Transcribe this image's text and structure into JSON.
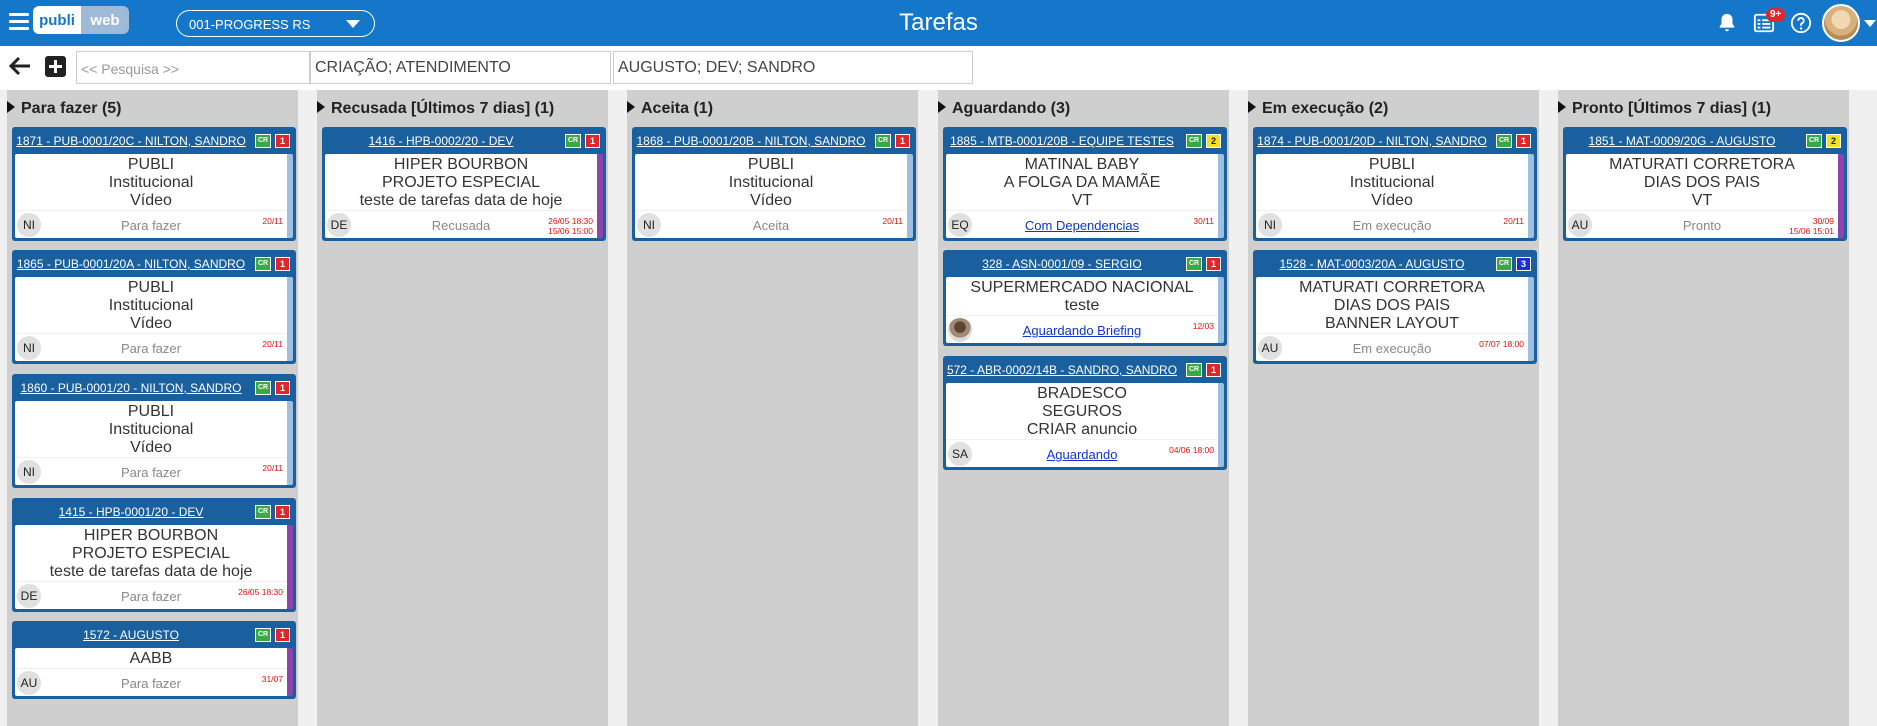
{
  "app": {
    "logo_left": "publi",
    "logo_right": "web",
    "page_title": "Tarefas",
    "notification_badge": "9+"
  },
  "colors": {
    "topbar": "#1577c9",
    "card_header": "#1a5f9e",
    "cr_badge": "#3aa845",
    "date_red": "#e01010"
  },
  "topbar": {
    "project_select": "001-PROGRESS RS"
  },
  "filters": {
    "search_placeholder": "<< Pesquisa >>",
    "category_filter": "CRIAÇÃO; ATENDIMENTO",
    "people_filter": "AUGUSTO; DEV; SANDRO"
  },
  "columns": [
    {
      "title": "Para fazer (5)",
      "cards": [
        {
          "link": "1871 - PUB-0001/20C - NILTON, SANDRO",
          "badge": "CR",
          "count": "1",
          "count_color": "#e0262b",
          "lines": [
            "PUBLI",
            "Institucional",
            "Vídeo"
          ],
          "initials": "NI",
          "status": "Para fazer",
          "date1": "20/11",
          "date2": ""
        },
        {
          "link": "1865 - PUB-0001/20A - NILTON, SANDRO",
          "badge": "CR",
          "count": "1",
          "count_color": "#e0262b",
          "lines": [
            "PUBLI",
            "Institucional",
            "Vídeo"
          ],
          "initials": "NI",
          "status": "Para fazer",
          "date1": "20/11",
          "date2": ""
        },
        {
          "link": "1860 - PUB-0001/20 - NILTON, SANDRO",
          "badge": "CR",
          "count": "1",
          "count_color": "#e0262b",
          "lines": [
            "PUBLI",
            "Institucional",
            "Vídeo"
          ],
          "initials": "NI",
          "status": "Para fazer",
          "date1": "20/11",
          "date2": ""
        },
        {
          "link": "1415 - HPB-0001/20 - DEV",
          "badge": "CR",
          "count": "1",
          "count_color": "#e0262b",
          "lines": [
            "HIPER BOURBON",
            "PROJETO ESPECIAL",
            "teste de tarefas data de hoje"
          ],
          "initials": "DE",
          "status": "Para fazer",
          "date1": "26/05 18:30",
          "date2": "",
          "purple": true
        },
        {
          "link": "1572 - AUGUSTO",
          "badge": "CR",
          "count": "1",
          "count_color": "#e0262b",
          "lines": [
            "AABB"
          ],
          "initials": "AU",
          "status": "Para fazer",
          "date1": "31/07",
          "date2": "",
          "purple": true
        }
      ]
    },
    {
      "title": "Recusada [Últimos 7 dias] (1)",
      "cards": [
        {
          "link": "1416 - HPB-0002/20 - DEV",
          "badge": "CR",
          "count": "1",
          "count_color": "#e0262b",
          "lines": [
            "HIPER BOURBON",
            "PROJETO ESPECIAL",
            "teste de tarefas data de hoje"
          ],
          "initials": "DE",
          "status": "Recusada",
          "date1": "26/05 18:30",
          "date2": "15/06 15:00",
          "purple": true
        }
      ]
    },
    {
      "title": "Aceita (1)",
      "cards": [
        {
          "link": "1868 - PUB-0001/20B - NILTON, SANDRO",
          "badge": "CR",
          "count": "1",
          "count_color": "#e0262b",
          "lines": [
            "PUBLI",
            "Institucional",
            "Vídeo"
          ],
          "initials": "NI",
          "status": "Aceita",
          "date1": "20/11",
          "date2": ""
        }
      ]
    },
    {
      "title": "Aguardando (3)",
      "cards": [
        {
          "link": "1885 - MTB-0001/20B - EQUIPE TESTES",
          "badge": "CR",
          "count": "2",
          "count_color": "#f2e21a",
          "lines": [
            "MATINAL BABY",
            "A FOLGA DA MAMÃE",
            "VT"
          ],
          "initials": "EQ",
          "status": "Com Dependencias",
          "status_link": true,
          "date1": "30/11",
          "date2": ""
        },
        {
          "link": "328 - ASN-0001/09 - SERGIO",
          "badge": "CR",
          "count": "1",
          "count_color": "#e0262b",
          "lines": [
            "SUPERMERCADO NACIONAL",
            "teste"
          ],
          "initials": "",
          "face": true,
          "status": "Aguardando Briefing",
          "status_link": true,
          "date1": "12/03",
          "date2": ""
        },
        {
          "link": "572 - ABR-0002/14B - SANDRO, SANDRO",
          "badge": "CR",
          "count": "1",
          "count_color": "#e0262b",
          "lines": [
            "BRADESCO",
            "SEGUROS",
            "CRIAR anuncio"
          ],
          "initials": "SA",
          "status": "Aguardando",
          "status_link": true,
          "date1": "04/06 18:00",
          "date2": ""
        }
      ]
    },
    {
      "title": "Em execução (2)",
      "cards": [
        {
          "link": "1874 - PUB-0001/20D - NILTON, SANDRO",
          "badge": "CR",
          "count": "1",
          "count_color": "#e0262b",
          "lines": [
            "PUBLI",
            "Institucional",
            "Vídeo"
          ],
          "initials": "NI",
          "status": "Em execução",
          "date1": "20/11",
          "date2": ""
        },
        {
          "link": "1528 - MAT-0003/20A - AUGUSTO",
          "badge": "CR",
          "count": "3",
          "count_color": "#1a2fd6",
          "lines": [
            "MATURATI CORRETORA",
            "DIAS DOS PAIS",
            "BANNER LAYOUT"
          ],
          "initials": "AU",
          "status": "Em execução",
          "date1": "07/07 18:00",
          "date2": ""
        }
      ]
    },
    {
      "title": "Pronto [Últimos 7 dias] (1)",
      "cards": [
        {
          "link": "1851 - MAT-0009/20G - AUGUSTO",
          "badge": "CR",
          "count": "2",
          "count_color": "#f2e21a",
          "lines": [
            "MATURATI CORRETORA",
            "DIAS DOS PAIS",
            "VT"
          ],
          "initials": "AU",
          "status": "Pronto",
          "date1": "30/09",
          "date2": "15/06 15:01",
          "purple": true
        }
      ]
    }
  ]
}
